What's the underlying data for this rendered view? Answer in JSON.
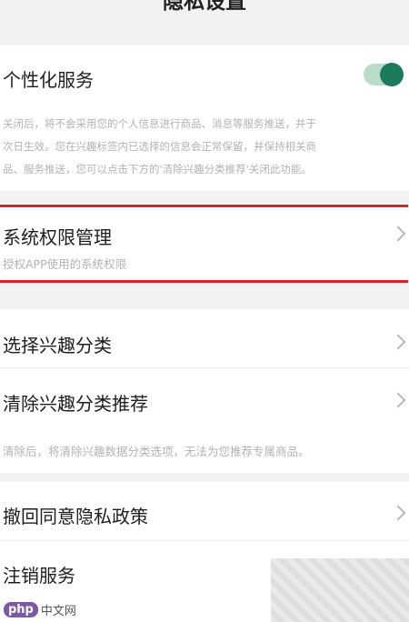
{
  "header": {
    "title": "隐私设置"
  },
  "personalized": {
    "title": "个性化服务",
    "toggle_on": true,
    "desc_lines": [
      "关闭后，将不会采用您的个人信息进行商品、消息等服务推送，并于",
      "次日生效。您在兴趣标签内已选择的信息会正常保留，并保持相关商",
      "品、服务推送，您可以点击下方的'清除兴趣分类推荐'关闭此功能。"
    ]
  },
  "permissions": {
    "title": "系统权限管理",
    "subtitle": "授权APP使用的系统权限"
  },
  "interests": {
    "select_title": "选择兴趣分类",
    "clear_title": "清除兴趣分类推荐",
    "clear_desc": "清除后，将清除兴趣数据分类选项，无法为您推荐专属商品。"
  },
  "privacy": {
    "revoke_title": "撤回同意隐私政策",
    "cancel_title": "注销服务"
  },
  "watermark": {
    "logo": "php",
    "text": "中文网"
  },
  "colors": {
    "accent": "#1d7a5c",
    "highlight": "#d4232c"
  }
}
